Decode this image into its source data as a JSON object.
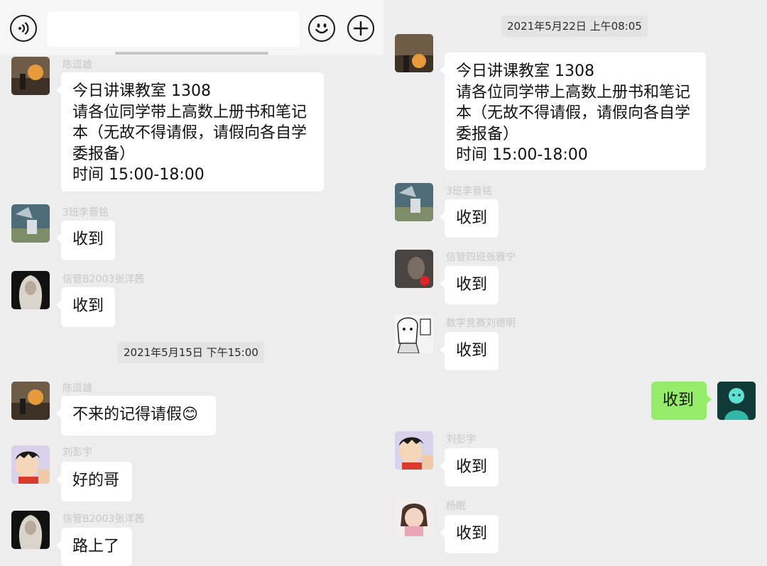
{
  "left": {
    "input_bar": {
      "voice_icon": "voice-icon",
      "emoji_icon": "emoji-icon",
      "plus_icon": "plus-icon",
      "input_value": ""
    },
    "timestamps": [
      "2021年5月15日 下午15:00"
    ],
    "messages": [
      {
        "sender": "陈逗雄",
        "text": "今日讲课教室 1308\n请各位同学带上高数上册书和笔记\n本（无故不得请假，请假向各自学\n委报备）\n时间 15:00-18:00"
      },
      {
        "sender": "3班李晋铭",
        "text": "收到"
      },
      {
        "sender": "信管B2003张洋茜",
        "text": "收到"
      },
      {
        "sender": "陈逗雄",
        "text": "不来的记得请假😊"
      },
      {
        "sender": "刘彭宇",
        "text": "好的哥"
      },
      {
        "sender": "信管B2003张洋茜",
        "text": "路上了"
      }
    ]
  },
  "right": {
    "timestamps": [
      "2021年5月22日 上午08:05"
    ],
    "messages": [
      {
        "sender": "",
        "text": "今日讲课教室 1308\n请各位同学带上高数上册书和笔记\n本（无故不得请假，请假向各自学\n委报备）\n时间 15:00-18:00"
      },
      {
        "sender": "3班李晋铭",
        "text": "收到"
      },
      {
        "sender": "信管四班张雅宁",
        "text": "收到"
      },
      {
        "sender": "数学竞赛刘德明",
        "text": "收到"
      },
      {
        "sender": "",
        "text": "收到",
        "self": true
      },
      {
        "sender": "刘彭宇",
        "text": "收到"
      },
      {
        "sender": "杨眠",
        "text": "收到"
      }
    ]
  },
  "colors": {
    "chat_background": "#ededed",
    "bubble_incoming": "#ffffff",
    "bubble_outgoing": "#95ec69",
    "timestamp_background": "#e4e4e4",
    "sender_name": "#c8c8c8"
  }
}
